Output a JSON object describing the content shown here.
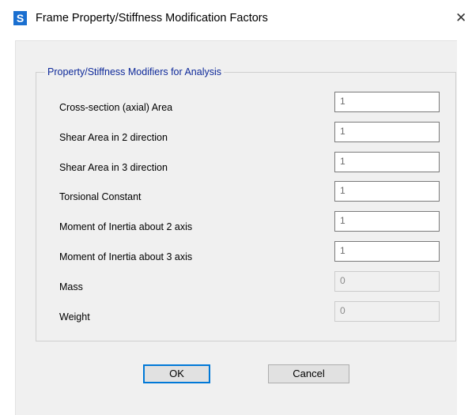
{
  "window": {
    "app_icon_letter": "S",
    "title": "Frame Property/Stiffness Modification Factors",
    "close_glyph": "✕"
  },
  "group": {
    "title": "Property/Stiffness Modifiers for Analysis"
  },
  "rows": [
    {
      "label": "Cross-section (axial) Area",
      "value": "1",
      "enabled": true
    },
    {
      "label": "Shear Area in 2 direction",
      "value": "1",
      "enabled": true
    },
    {
      "label": "Shear Area in 3 direction",
      "value": "1",
      "enabled": true
    },
    {
      "label": "Torsional Constant",
      "value": "1",
      "enabled": true
    },
    {
      "label": "Moment of Inertia about 2 axis",
      "value": "1",
      "enabled": true
    },
    {
      "label": "Moment of Inertia about 3 axis",
      "value": "1",
      "enabled": true
    },
    {
      "label": "Mass",
      "value": "0",
      "enabled": false
    },
    {
      "label": "Weight",
      "value": "0",
      "enabled": false
    }
  ],
  "buttons": {
    "ok_label": "OK",
    "cancel_label": "Cancel"
  },
  "colors": {
    "app_icon": "#1a6fd0",
    "group_title": "#0f2a9a",
    "ok_focus_border": "#0078d7"
  }
}
